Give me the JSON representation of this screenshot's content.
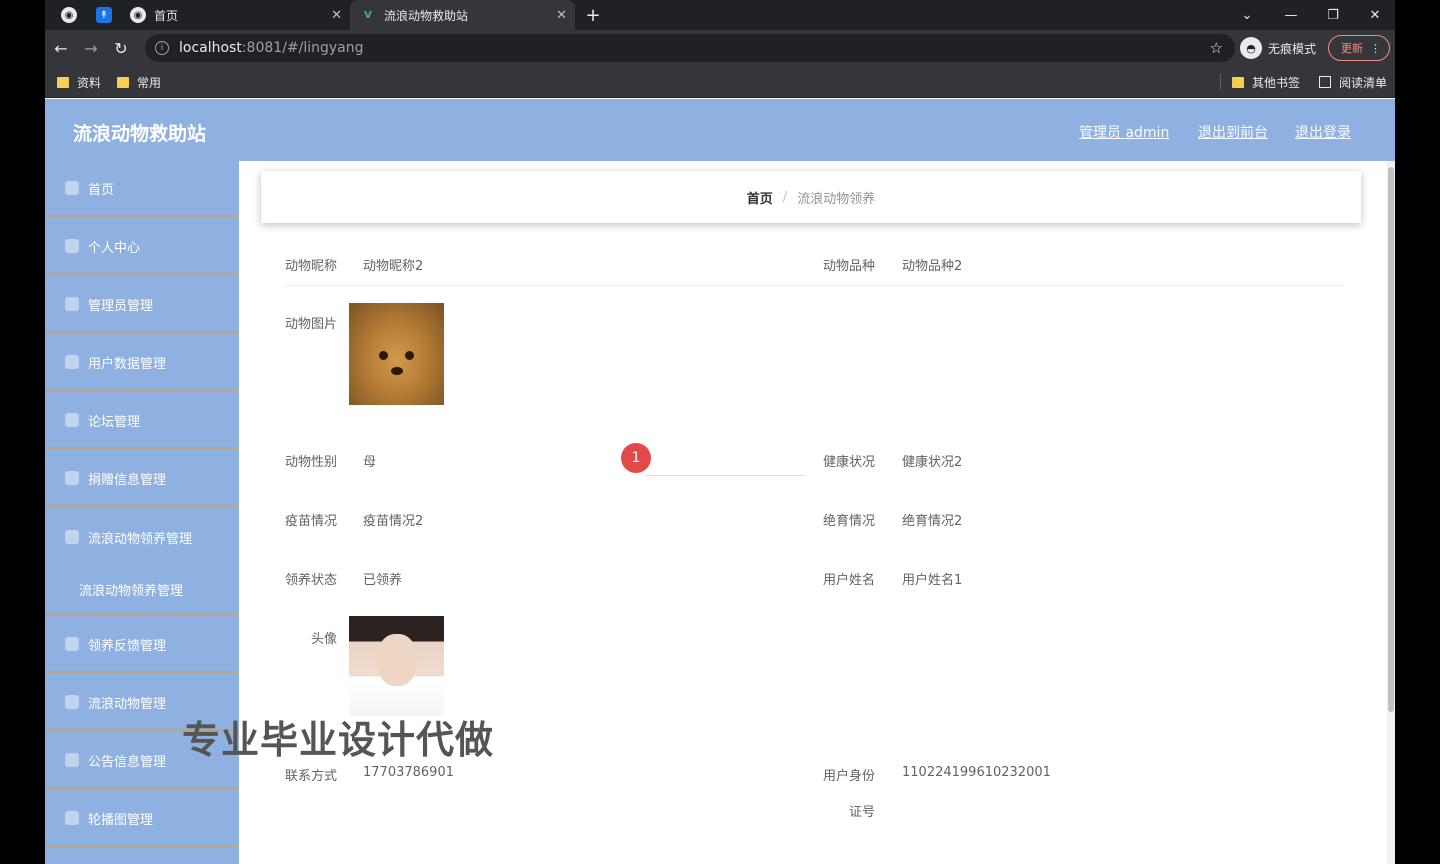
{
  "browser": {
    "tabs": [
      {
        "label": "首页",
        "active": false
      },
      {
        "label": "流浪动物救助站",
        "active": true
      }
    ],
    "url_host": "localhost",
    "url_rest": ":8081/#/lingyang",
    "incognito_label": "无痕模式",
    "update_label": "更新",
    "bookmarks_left": [
      "资料",
      "常用"
    ],
    "bookmarks_right": [
      "其他书签",
      "阅读清单"
    ]
  },
  "site": {
    "title": "流浪动物救助站",
    "header_links": [
      "管理员 admin",
      "退出到前台",
      "退出登录"
    ]
  },
  "sidebar": {
    "items": [
      "首页",
      "个人中心",
      "管理员管理",
      "用户数据管理",
      "论坛管理",
      "捐赠信息管理",
      "流浪动物领养管理"
    ],
    "sub_item": "流浪动物领养管理",
    "items_after": [
      "领养反馈管理",
      "流浪动物管理",
      "公告信息管理",
      "轮播图管理"
    ]
  },
  "breadcrumb": {
    "home": "首页",
    "separator": "/",
    "current": "流浪动物领养"
  },
  "form": {
    "pet_name_label": "动物昵称",
    "pet_name_value": "动物昵称2",
    "breed_label": "动物品种",
    "breed_value": "动物品种2",
    "photo_label": "动物图片",
    "gender_label": "动物性别",
    "gender_value": "母",
    "health_label": "健康状况",
    "health_value": "健康状况2",
    "vaccine_label": "疫苗情况",
    "vaccine_value": "疫苗情况2",
    "sterile_label": "绝育情况",
    "sterile_value": "绝育情况2",
    "adopt_status_label": "领养状态",
    "adopt_status_value": "已领养",
    "user_name_label": "用户姓名",
    "user_name_value": "用户姓名1",
    "avatar_label": "头像",
    "contact_label": "联系方式",
    "contact_value": "17703786901",
    "id_card_label": "用户身份",
    "id_card_label2": "证号",
    "id_card_value": "110224199610232001"
  },
  "overlay": {
    "cursor_number": "1",
    "watermark": "专业毕业设计代做"
  }
}
